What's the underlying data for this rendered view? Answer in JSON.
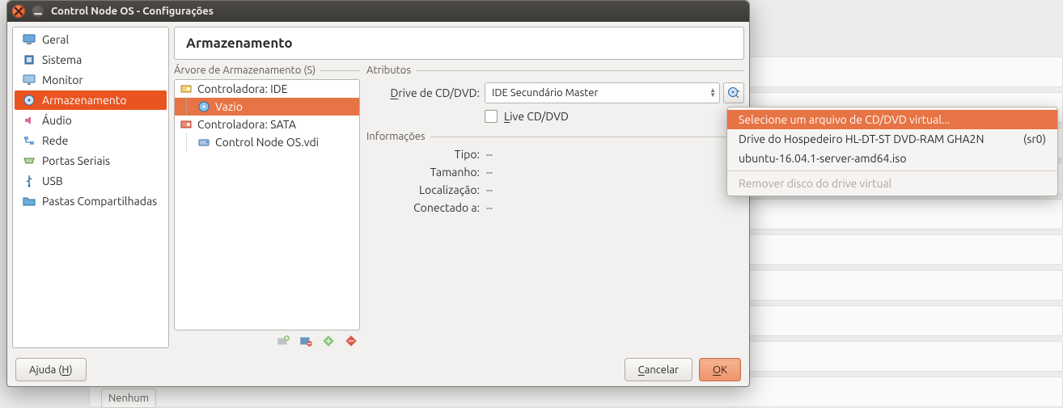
{
  "window_title": "Control Node OS - Configurações",
  "sidebar": {
    "items": [
      {
        "label": "Geral",
        "icon": "monitor"
      },
      {
        "label": "Sistema",
        "icon": "chip"
      },
      {
        "label": "Monitor",
        "icon": "display"
      },
      {
        "label": "Armazenamento",
        "icon": "disk",
        "selected": true
      },
      {
        "label": "Áudio",
        "icon": "audio"
      },
      {
        "label": "Rede",
        "icon": "net"
      },
      {
        "label": "Portas Seriais",
        "icon": "serial"
      },
      {
        "label": "USB",
        "icon": "usb"
      },
      {
        "label": "Pastas Compartilhadas",
        "icon": "folder"
      }
    ]
  },
  "main": {
    "header": "Armazenamento",
    "tree_group_label": "Árvore de Armazenamento (S)",
    "tree": [
      {
        "label": "Controladora: IDE",
        "icon": "ide",
        "children": [
          {
            "label": "Vazio",
            "icon": "cd",
            "selected": true
          }
        ]
      },
      {
        "label": "Controladora: SATA",
        "icon": "sata",
        "children": [
          {
            "label": "Control Node OS.vdi",
            "icon": "hdd"
          }
        ]
      }
    ],
    "attr_group_label": "Atributos",
    "drive_label_pre": "D",
    "drive_label_post": "rive de CD/DVD:",
    "drive_value": "IDE Secundário Master",
    "live_label_pre": "L",
    "live_label_post": "ive CD/DVD",
    "info_group_label": "Informações",
    "info": [
      {
        "label": "Tipo:",
        "value": "--"
      },
      {
        "label": "Tamanho:",
        "value": "--"
      },
      {
        "label": "Localização:",
        "value": "--"
      },
      {
        "label": "Conectado a:",
        "value": "--"
      }
    ]
  },
  "footer": {
    "help_pre": "Ajuda (",
    "help_u": "H",
    "help_post": ")",
    "cancel_pre": "",
    "cancel_u": "C",
    "cancel_post": "ancelar",
    "ok_pre": "",
    "ok_u": "O",
    "ok_post": "K"
  },
  "menu": {
    "items": [
      {
        "label": "Selecione um arquivo de CD/DVD virtual...",
        "selected": true
      },
      {
        "label": "Drive do Hospedeiro HL-DT-ST DVD-RAM GHA2N",
        "extra": "(sr0)"
      },
      {
        "label": "ubuntu-16.04.1-server-amd64.iso"
      }
    ],
    "disabled": "Remover disco do drive virtual"
  },
  "background_footer": "Nenhum"
}
